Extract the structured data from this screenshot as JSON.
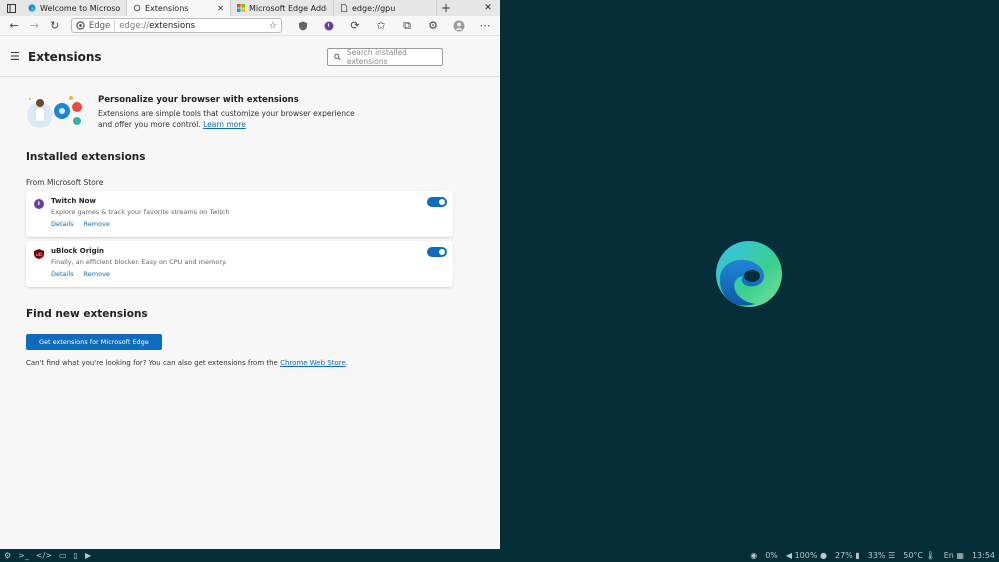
{
  "tabs": [
    {
      "title": "Welcome to Microsoft Edge",
      "active": false
    },
    {
      "title": "Extensions",
      "active": true
    },
    {
      "title": "Microsoft Edge Add-ons",
      "active": false
    },
    {
      "title": "edge://gpu",
      "active": false
    }
  ],
  "toolbar": {
    "address_site": "Edge",
    "address_scheme": "edge://",
    "address_path": "extensions"
  },
  "page": {
    "title": "Extensions",
    "search_placeholder": "Search installed extensions",
    "promo": {
      "title": "Personalize your browser with extensions",
      "description": "Extensions are simple tools that customize your browser experience and offer you more control.",
      "link": "Learn more"
    },
    "installed_heading": "Installed extensions",
    "source_label": "From Microsoft Store",
    "extensions": [
      {
        "name": "Twitch Now",
        "description": "Explore games & track your favorite streams on Twitch",
        "details": "Details",
        "remove": "Remove",
        "enabled": true
      },
      {
        "name": "uBlock Origin",
        "description": "Finally, an efficient blocker. Easy on CPU and memory.",
        "details": "Details",
        "remove": "Remove",
        "enabled": true
      }
    ],
    "find_heading": "Find new extensions",
    "get_button": "Get extensions for Microsoft Edge",
    "note_prefix": "Can't find what you're looking for? You can also get extensions from the",
    "note_link": "Chrome Web Store",
    "note_suffix": "."
  },
  "taskbar": {
    "volume_level": "0%",
    "audio": "100%",
    "cpu": "27%",
    "memory": "33%",
    "temperature": "50°C",
    "language": "En",
    "clock": "13:54"
  },
  "colors": {
    "accent": "#0f6cbd",
    "desktop": "#052e38"
  }
}
